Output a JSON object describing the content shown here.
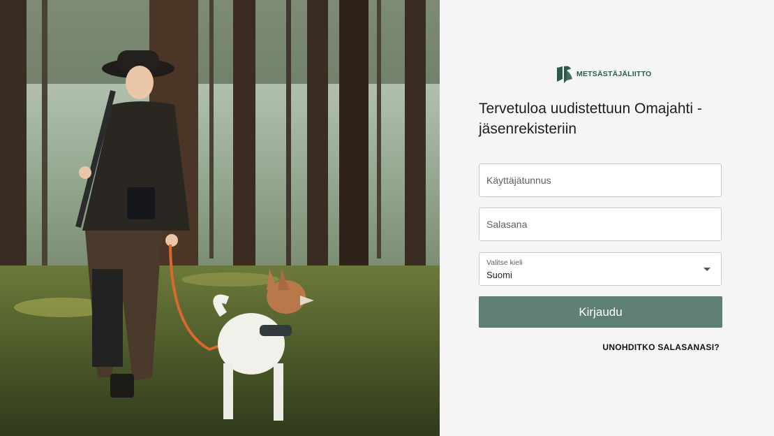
{
  "brand": {
    "logo_text": "METSÄSTÄJÄLIITTO",
    "logo_icon": "leaf-bird-logo",
    "color": "#2d5a4c"
  },
  "hero": {
    "image": "forest-hunter-with-dog-photo"
  },
  "login": {
    "title": "Tervetuloa uudistettuun Omajahti -jäsenrekisteriin",
    "username_placeholder": "Käyttäjätunnus",
    "password_placeholder": "Salasana",
    "language": {
      "label": "Valitse kieli",
      "selected": "Suomi"
    },
    "submit_label": "Kirjaudu",
    "forgot_label": "UNOHDITKO SALASANASI?",
    "accent_color": "#5f7f75"
  }
}
